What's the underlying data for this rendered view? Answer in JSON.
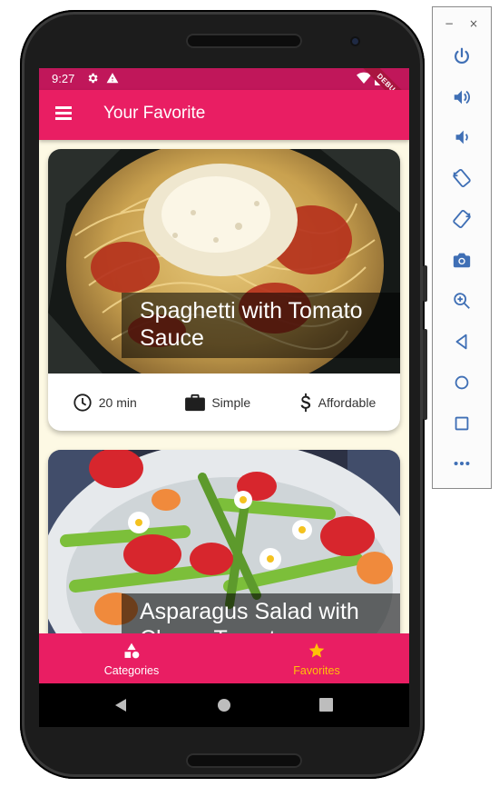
{
  "status_bar": {
    "time": "9:27",
    "debug_label": "DEBUG"
  },
  "app_bar": {
    "title": "Your Favorite"
  },
  "meals": [
    {
      "title": "Spaghetti with Tomato Sauce",
      "duration": "20 min",
      "complexity": "Simple",
      "affordability": "Affordable"
    },
    {
      "title": "Asparagus Salad with Cherry Tomatoes"
    }
  ],
  "bottom_nav": {
    "categories_label": "Categories",
    "favorites_label": "Favorites",
    "active_tab": "Favorites"
  },
  "icons": {
    "menu": "menu-icon",
    "status": [
      "settings-icon",
      "warning-icon",
      "wifi-icon",
      "battery-icon"
    ],
    "meta": [
      "clock-icon",
      "briefcase-icon",
      "dollar-icon"
    ],
    "nav": [
      "category-icon",
      "star-icon"
    ],
    "system_nav": [
      "back-icon",
      "home-icon",
      "recents-icon"
    ],
    "emulator_panel": [
      "power-icon",
      "volume-up-icon",
      "volume-down-icon",
      "rotate-left-icon",
      "rotate-right-icon",
      "camera-icon",
      "zoom-icon",
      "back-icon",
      "home-icon",
      "overview-icon",
      "more-icon"
    ]
  },
  "colors": {
    "primary": "#e91e63",
    "status_bar": "#c0175a",
    "accent": "#ffc107",
    "background": "#fdf9e4"
  }
}
